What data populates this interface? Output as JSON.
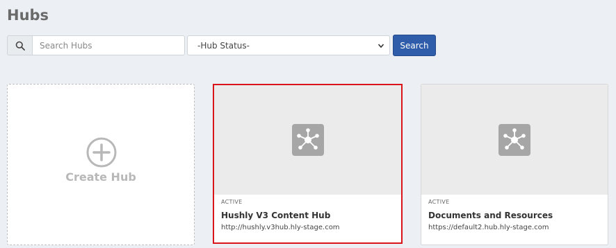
{
  "page": {
    "title": "Hubs"
  },
  "search": {
    "placeholder": "Search Hubs",
    "value": "",
    "status_selected": "-Hub Status-",
    "button_label": "Search"
  },
  "create_card": {
    "label": "Create Hub"
  },
  "hubs": [
    {
      "status": "ACTIVE",
      "name": "Hushly V3 Content Hub",
      "url": "http://hushly.v3hub.hly-stage.com",
      "selected": true
    },
    {
      "status": "ACTIVE",
      "name": "Documents and Resources",
      "url": "https://default2.hub.hly-stage.com",
      "selected": false
    }
  ],
  "colors": {
    "background": "#eceff4",
    "primary_button": "#2f5daa",
    "selection_outline": "#d9141b",
    "thumbnail_bg": "#ebebeb",
    "hub_icon": "#a6a6a6"
  },
  "icons": {
    "search": "search-icon",
    "dropdown": "chevron-down-icon",
    "create": "plus-circle-icon",
    "hub": "network-hub-icon"
  }
}
